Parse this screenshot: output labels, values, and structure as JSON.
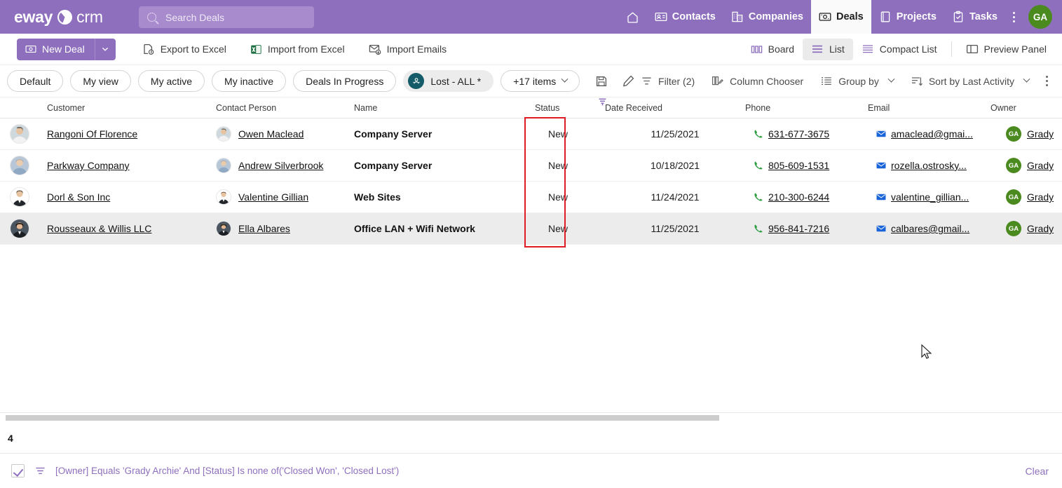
{
  "app": {
    "brand_name": "eway",
    "brand_suffix": "crm",
    "brand_mark_icon": "eway-logo-icon"
  },
  "search": {
    "placeholder": "Search Deals",
    "value": "",
    "icon": "search-icon"
  },
  "nav": {
    "home_icon": "home-icon",
    "items": [
      {
        "label": "Contacts",
        "icon": "contacts-card-icon",
        "active": false
      },
      {
        "label": "Companies",
        "icon": "building-icon",
        "active": false
      },
      {
        "label": "Deals",
        "icon": "deals-icon",
        "active": true
      },
      {
        "label": "Projects",
        "icon": "book-icon",
        "active": false
      },
      {
        "label": "Tasks",
        "icon": "clipboard-check-icon",
        "active": false
      }
    ],
    "overflow_icon": "kebab-menu-icon",
    "avatar_initials": "GA",
    "avatar_color": "#4a8a1e"
  },
  "toolbar": {
    "new_deal_label": "New Deal",
    "new_deal_icon": "deal-icon",
    "new_deal_dropdown_icon": "chevron-down-icon",
    "accent_color": "#8e6fbd",
    "actions": [
      {
        "label": "Export to Excel",
        "icon": "export-excel-icon"
      },
      {
        "label": "Import from Excel",
        "icon": "import-excel-icon"
      },
      {
        "label": "Import Emails",
        "icon": "import-emails-icon"
      }
    ],
    "views": [
      {
        "label": "Board",
        "icon": "board-view-icon",
        "selected": false
      },
      {
        "label": "List",
        "icon": "list-view-icon",
        "selected": true
      },
      {
        "label": "Compact List",
        "icon": "compact-list-icon",
        "selected": false
      },
      {
        "label": "Preview Panel",
        "icon": "preview-panel-icon",
        "selected": false
      }
    ]
  },
  "chips": {
    "items": [
      {
        "label": "Default",
        "filled": false,
        "avatar": false
      },
      {
        "label": "My view",
        "filled": false,
        "avatar": false
      },
      {
        "label": "My active",
        "filled": false,
        "avatar": false
      },
      {
        "label": "My inactive",
        "filled": false,
        "avatar": false
      },
      {
        "label": "Deals In Progress",
        "filled": false,
        "avatar": false
      },
      {
        "label": "Lost - ALL *",
        "filled": true,
        "avatar": true,
        "avatar_icon": "group-users-icon",
        "avatar_color": "#135b68"
      },
      {
        "label": "+17 items",
        "filled": false,
        "avatar": false,
        "chevron": true
      }
    ],
    "save_icon": "save-disk-icon",
    "edit_icon": "pencil-edit-icon"
  },
  "grid_tools": {
    "filter_label": "Filter (2)",
    "filter_icon": "filter-icon",
    "column_chooser_label": "Column Chooser",
    "column_chooser_icon": "column-chooser-icon",
    "group_by_label": "Group by",
    "group_by_icon": "group-by-icon",
    "sort_label": "Sort by Last Activity",
    "sort_icon": "sort-icon",
    "overflow_icon": "kebab-menu-icon"
  },
  "table": {
    "columns": [
      {
        "key": "customer",
        "label": "Customer"
      },
      {
        "key": "contact",
        "label": "Contact Person"
      },
      {
        "key": "name",
        "label": "Name"
      },
      {
        "key": "status",
        "label": "Status",
        "filter_icon": "column-filter-icon",
        "filtered": true
      },
      {
        "key": "date",
        "label": "Date Received"
      },
      {
        "key": "phone",
        "label": "Phone"
      },
      {
        "key": "email",
        "label": "Email"
      },
      {
        "key": "owner",
        "label": "Owner"
      }
    ],
    "rows": [
      {
        "customer": "Rangoni Of Florence",
        "contact": "Owen Maclead",
        "name": "Company Server",
        "status": "New",
        "date": "11/25/2021",
        "phone": "631-677-3675",
        "email": "amaclead@gmai...",
        "owner": "Grady",
        "owner_initials": "GA",
        "selected": false
      },
      {
        "customer": "Parkway Company",
        "contact": "Andrew Silverbrook",
        "name": "Company Server",
        "status": "New",
        "date": "10/18/2021",
        "phone": "805-609-1531",
        "email": "rozella.ostrosky...",
        "owner": "Grady",
        "owner_initials": "GA",
        "selected": false
      },
      {
        "customer": "Dorl & Son Inc",
        "contact": "Valentine Gillian",
        "name": "Web Sites",
        "status": "New",
        "date": "11/24/2021",
        "phone": "210-300-6244",
        "email": "valentine_gillian...",
        "owner": "Grady",
        "owner_initials": "GA",
        "selected": false
      },
      {
        "customer": "Rousseaux & Willis LLC",
        "contact": "Ella Albares",
        "name": "Office LAN + Wifi Network",
        "status": "New",
        "date": "11/25/2021",
        "phone": "956-841-7216",
        "email": "calbares@gmail...",
        "owner": "Grady",
        "owner_initials": "GA",
        "selected": true
      }
    ]
  },
  "annotation": {
    "highlight_color": "#e01b24",
    "target_column": "Status"
  },
  "footer": {
    "record_count": "4",
    "filter_expression": "[Owner] Equals 'Grady Archie' And [Status] Is none of('Closed Won', 'Closed Lost')",
    "filter_enabled": true,
    "filter_icon": "filter-icon",
    "clear_label": "Clear",
    "accent_color": "#8e6fbd"
  }
}
